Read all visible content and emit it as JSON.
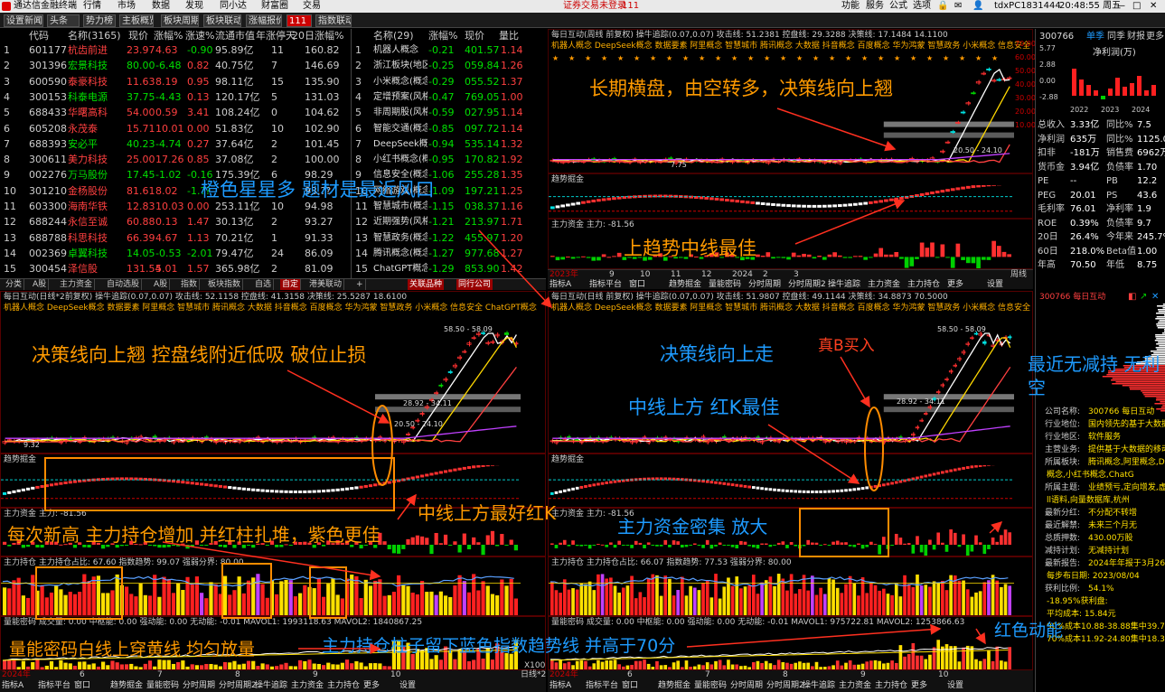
{
  "menubar": {
    "app_title": "通达信金融终端",
    "items": [
      "行情",
      "市场",
      "数据",
      "发现",
      "同小达",
      "财富圈",
      "交易"
    ],
    "notice": "证券交易未登录",
    "notice_num": "111",
    "right_items": [
      "功能",
      "服务",
      "公式",
      "选项"
    ],
    "account": "tdxPC1831444",
    "time": "20:48:55 周五"
  },
  "tabs": [
    "设置新闻",
    "头条",
    "势力榜",
    "主板概览",
    "板块周期",
    "板块联动",
    "涨幅报价",
    "111",
    "指数联动"
  ],
  "stock_table": {
    "headers": [
      "代码",
      "名称(3165)",
      "现价",
      "涨幅%",
      "涨速%",
      "流通市值",
      "年涨停天",
      "20日涨幅%"
    ],
    "rows": [
      [
        "1",
        "601177",
        "杭齿前进",
        "23.97",
        "4.63",
        "-0.90",
        "95.89亿",
        "11",
        "160.82"
      ],
      [
        "2",
        "301396",
        "宏景科技",
        "80.00",
        "-6.48",
        "0.82",
        "40.75亿",
        "7",
        "146.69"
      ],
      [
        "3",
        "600590",
        "泰豪科技",
        "11.63",
        "8.19",
        "0.95",
        "98.11亿",
        "15",
        "135.90"
      ],
      [
        "4",
        "300153",
        "科泰电源",
        "37.75",
        "-4.43",
        "0.13",
        "120.17亿",
        "5",
        "131.03"
      ],
      [
        "5",
        "688433",
        "华曙高科",
        "54.00",
        "0.59",
        "3.41",
        "108.24亿",
        "0",
        "104.62"
      ],
      [
        "6",
        "605208",
        "永茂泰",
        "15.71",
        "10.01",
        "0.00",
        "51.83亿",
        "10",
        "102.90"
      ],
      [
        "7",
        "688393",
        "安必平",
        "40.23",
        "-4.74",
        "0.27",
        "37.64亿",
        "2",
        "101.45"
      ],
      [
        "8",
        "300611",
        "美力科技",
        "25.00",
        "17.26",
        "0.85",
        "37.08亿",
        "2",
        "100.00"
      ],
      [
        "9",
        "002276",
        "万马股份",
        "17.45",
        "-1.02",
        "-0.16",
        "175.39亿",
        "6",
        "98.29"
      ],
      [
        "10",
        "301210",
        "金杨股份",
        "81.61",
        "8.02",
        "-1.??",
        "",
        "",
        "93.??"
      ],
      [
        "11",
        "603300",
        "海南华铁",
        "12.83",
        "10.03",
        "0.00",
        "253.11亿",
        "10",
        "94.98"
      ],
      [
        "12",
        "688244",
        "永信至诚",
        "60.88",
        "0.13",
        "1.47",
        "30.13亿",
        "2",
        "93.27"
      ],
      [
        "13",
        "688788",
        "科思科技",
        "66.39",
        "4.67",
        "1.13",
        "70.21亿",
        "1",
        "91.33"
      ],
      [
        "14",
        "002369",
        "卓翼科技",
        "14.05",
        "-0.53",
        "-2.01",
        "79.47亿",
        "24",
        "86.09"
      ],
      [
        "15",
        "300454",
        "泽信股",
        "131.54",
        "5.01",
        "1.57",
        "365.98亿",
        "2",
        "81.09"
      ]
    ]
  },
  "concept_table": {
    "headers": [
      "名称(29)",
      "涨幅%",
      "现价",
      "量比"
    ],
    "rows": [
      [
        "1",
        "机器人概念",
        "-0.21",
        "401.57",
        "1.14"
      ],
      [
        "2",
        "浙江板块(地区)",
        "-0.25",
        "059.84",
        "1.26"
      ],
      [
        "3",
        "小米概念(概念)",
        "-0.29",
        "055.52",
        "1.37"
      ],
      [
        "4",
        "定增预案(风格)",
        "-0.47",
        "769.05",
        "1.00"
      ],
      [
        "5",
        "非周期股(风格)",
        "-0.59",
        "027.95",
        "1.14"
      ],
      [
        "6",
        "智能交通(概念)",
        "-0.85",
        "097.72",
        "1.14"
      ],
      [
        "7",
        "DeepSeek概念",
        "-0.94",
        "535.14",
        "1.32"
      ],
      [
        "8",
        "小红书概念(概念)",
        "-0.95",
        "170.82",
        "1.92"
      ],
      [
        "9",
        "信息安全(概念)",
        "-1.06",
        "255.28",
        "1.35"
      ],
      [
        "10",
        "网络游戏(概念)",
        "-1.09",
        "197.21",
        "1.25"
      ],
      [
        "11",
        "智慧城市(概念)",
        "-1.15",
        "038.37",
        "1.16"
      ],
      [
        "12",
        "近期强势(风格)",
        "-1.21",
        "213.97",
        "1.71"
      ],
      [
        "13",
        "智慧政务(概念)",
        "-1.22",
        "455.97",
        "1.20"
      ],
      [
        "14",
        "腾讯概念(概念)",
        "-1.27",
        "977.68",
        "1.27"
      ],
      [
        "15",
        "ChatGPT概念",
        "-1.29",
        "853.90",
        "1.42"
      ]
    ]
  },
  "bottom_tabs": [
    "分类",
    "A股",
    "主力资金",
    "自动选股",
    "A股",
    "指数",
    "板块指数",
    "自选",
    "自定",
    "港美联动",
    "+"
  ],
  "bottom_tabs2": [
    "关联品种",
    "同行公司"
  ],
  "chart_headers": {
    "top_right": "每日互动(周线 前复权) 操牛追踪(0.07,0.07) 攻击线: 51.2381 控盘线: 29.3288 决策线: 17.1484 14.1100",
    "mid_left": "每日互动(日线*2前复权) 操牛追踪(0.07,0.07) 攻击线: 52.1158 控盘线: 41.3158 决策线: 25.5287 18.6100",
    "mid_right": "每日互动(日线 前复权) 操牛追踪(0.07,0.07) 攻击线: 51.9807 控盘线: 49.1144 决策线: 34.8873 70.5000",
    "concept_line": "机器人概念 DeepSeek概念 数据要素 阿里概念 智慧城市 腾讯概念 大数据 抖音概念 百度概念 华为鸿蒙 智慧政务 小米概念 信息安全 ChatGPT概念",
    "trend": "趋势掘金",
    "fund": "主力资金 主力: -81.56",
    "hold": "主力持仓 主力持仓占比: 67.60 指数趋势: 99.07 强弱分界: 80.00",
    "hold_r": "主力持仓 主力持仓占比: 66.07 指数趋势: 77.53 强弱分界: 80.00",
    "vol": "量能密码 成交量: 0.00 中枢能: 0.00 强动能: 0.00 无动能: -0.01 MAVOL1: 1993118.63 MAVOL2: 1840867.25",
    "vol_r": "量能密码 成交量: 0.00 中枢能: 0.00 强动能: 0.00 无动能: -0.01 MAVOL1: 975722.81 MAVOL2: 1253866.63"
  },
  "chart_labels": {
    "price_a": "58.50 - 58.09",
    "price_b": "28.92 - 34.11",
    "price_c": "20.50 - 24.10",
    "price_low": "7.75",
    "price_low2": "9.32",
    "year_a": "2023年",
    "year_b": "2024年",
    "x_months": [
      "9",
      "10",
      "11",
      "12",
      "2024",
      "2",
      "3",
      "4",
      "5",
      "6",
      "7",
      "8",
      "9",
      "10",
      "11",
      "12",
      "2025",
      "2",
      "3"
    ],
    "y_top": [
      "70.00",
      "60.00",
      "50.00",
      "40.00",
      "30.00",
      "20.00",
      "10.00"
    ],
    "y_trend": [
      "100.0",
      "0.00"
    ],
    "y_fund": [
      "300.0",
      "0.00"
    ],
    "y_hold": [
      "100.0"
    ],
    "x100": "X100",
    "period": "周线",
    "period2": "日线*2",
    "cur_val": "8.35"
  },
  "annotations": {
    "a1": "长期横盘，由空转多，决策线向上翘",
    "a2": "橙色星星多 题材是最近风口",
    "a3": "上趋势中线最佳",
    "a4": "决策线向上翘 控盘线附近低吸 破位止损",
    "a5": "决策线向上走",
    "a6": "真B买入",
    "a7": "中线上方 红K最佳",
    "a8": "中线上方最好红K",
    "a9": "每次新高 主力持仓增加 并红柱扎堆，紫色更佳",
    "a10": "主力资金密集 放大",
    "a11": "量能密码白线上穿黄线 均匀放量",
    "a12": "主力持仓柱子留下蓝色指数趋势线 并高于70分",
    "a13": "红色动能",
    "a14": "最近无减持 无利空"
  },
  "right_panel": {
    "code": "300766",
    "tabs": [
      "单季",
      "同季",
      "财报",
      "更多"
    ],
    "bar_vals": [
      "5.77",
      "2.88",
      "0.00",
      "-2.88"
    ],
    "bar_years": [
      "2022",
      "2023",
      "2024"
    ],
    "bar_title": "净利润(万)",
    "fin": [
      [
        "总收入",
        "3.33亿",
        "同比%",
        "7.5"
      ],
      [
        "净利润",
        "635万",
        "同比%",
        "1125.0"
      ],
      [
        "扣非",
        "-181万",
        "销售费",
        "6962万"
      ],
      [
        "货币金",
        "3.94亿",
        "负债率",
        "1.70"
      ],
      [
        "PE",
        "--",
        "PB",
        "12.2"
      ],
      [
        "PEG",
        "20.01",
        "PS",
        "43.6"
      ],
      [
        "毛利率",
        "76.01",
        "净利率",
        "1.9"
      ],
      [
        "ROE",
        "0.39%",
        "负债率",
        "9.7"
      ],
      [
        "20日",
        "26.4%",
        "今年来",
        "245.7%"
      ],
      [
        "60日",
        "218.0%",
        "Beta值",
        "1.00"
      ],
      [
        "年高",
        "70.50",
        "年低",
        "8.75"
      ]
    ],
    "panel_title": "300766 每日互动",
    "company": [
      [
        "公司名称:",
        "300766 每日互动"
      ],
      [
        "行业地位:",
        "国内领先的基于大数据"
      ],
      [
        "行业地区:",
        "软件服务"
      ],
      [
        "主营业务:",
        "提供基于大数据的移动"
      ],
      [
        "所属板块:",
        "腾讯概念,阿里概念,Dee"
      ],
      [
        "",
        "概念,小红书概念,ChatG"
      ],
      [
        "所属主题:",
        "业绩预亏,定向增发,虚拟"
      ],
      [
        "",
        "ll语料,向量数据库,杭州"
      ],
      [
        "最新分红:",
        "不分配不转增"
      ],
      [
        "最近解禁:",
        "未来三个月无"
      ],
      [
        "总质押数:",
        "430.00万股"
      ],
      [
        "减持计划:",
        "无减持计划"
      ],
      [
        "最新报告:",
        "2024年年报于3月26日"
      ],
      [
        "",
        "每步布日期: 2023/08/04"
      ],
      [
        "获利比例:",
        "54.1%"
      ],
      [
        "",
        "-18.95%获利盘:"
      ],
      [
        "",
        "平均成本: 15.84元"
      ],
      [
        "",
        "90%成本10.88-38.88集中39.7%"
      ],
      [
        "",
        "70%成本11.92-24.80集中18.3%"
      ]
    ]
  },
  "bottom_status": [
    "指标A",
    "指标平台",
    "窗口",
    "趋势掘金",
    "量能密码",
    "分时周期",
    "分时周期2",
    "操牛追踪",
    "主力资金",
    "主力持仓",
    "更多",
    "设置"
  ]
}
